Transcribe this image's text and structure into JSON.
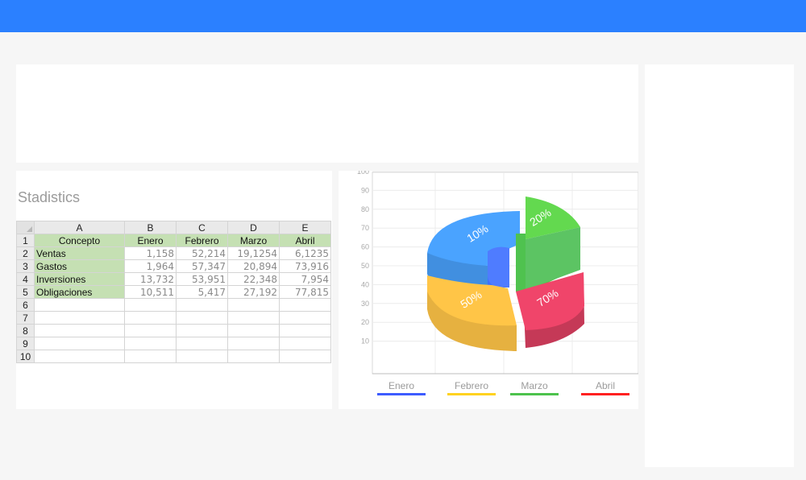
{
  "header": {
    "color": "#2b80ff"
  },
  "sheet": {
    "title": "Stadistics",
    "columns": [
      "A",
      "B",
      "C",
      "D",
      "E"
    ],
    "header_row": [
      "Concepto",
      "Enero",
      "Febrero",
      "Marzo",
      "Abril"
    ],
    "rows": [
      {
        "label": "Ventas",
        "values": [
          "1,158",
          "52,214",
          "19,1254",
          "6,1235"
        ]
      },
      {
        "label": "Gastos",
        "values": [
          "1,964",
          "57,347",
          "20,894",
          "73,916"
        ]
      },
      {
        "label": "Inversiones",
        "values": [
          "13,732",
          "53,951",
          "22,348",
          "7,954"
        ]
      },
      {
        "label": "Obligaciones",
        "values": [
          "10,511",
          "5,417",
          "27,192",
          "77,815"
        ]
      }
    ],
    "row_numbers": [
      "1",
      "2",
      "3",
      "4",
      "5",
      "6",
      "7",
      "8",
      "9",
      "10"
    ]
  },
  "chart_data": {
    "type": "pie",
    "style": "3d-exploded",
    "y_ticks": [
      10,
      20,
      30,
      40,
      50,
      60,
      70,
      80,
      90,
      100
    ],
    "grid": true,
    "legend_position": "bottom",
    "slices": [
      {
        "label": "Enero",
        "pct_label": "10%",
        "color": "#4aa3ff",
        "legend_color": "#3d5cff"
      },
      {
        "label": "Febrero",
        "pct_label": "50%",
        "color": "#ffc547",
        "legend_color": "#ffd21f"
      },
      {
        "label": "Marzo",
        "pct_label": "20%",
        "color": "#63d94f",
        "legend_color": "#4cc24c"
      },
      {
        "label": "Abril",
        "pct_label": "70%",
        "color": "#f0456a",
        "legend_color": "#ff2020"
      }
    ]
  }
}
